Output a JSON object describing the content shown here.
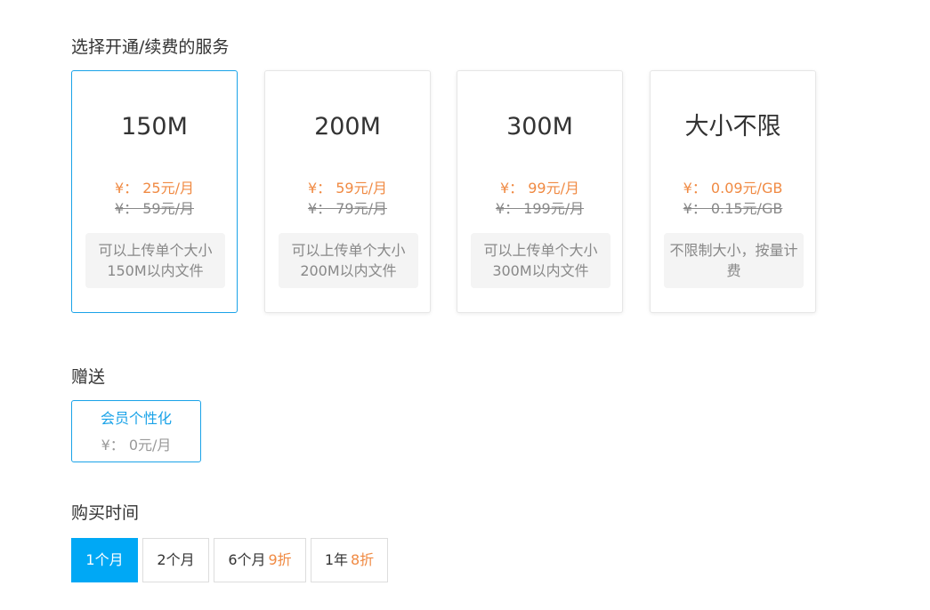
{
  "sections": {
    "service_title": "选择开通/续费的服务",
    "gift_title": "赠送",
    "duration_title": "购买时间"
  },
  "plans": [
    {
      "name": "150M",
      "price": "¥： 25元/月",
      "original_price": "¥： 59元/月",
      "description": "可以上传单个大小150M以内文件",
      "selected": true
    },
    {
      "name": "200M",
      "price": "¥： 59元/月",
      "original_price": "¥： 79元/月",
      "description": "可以上传单个大小200M以内文件",
      "selected": false
    },
    {
      "name": "300M",
      "price": "¥： 99元/月",
      "original_price": "¥： 199元/月",
      "description": "可以上传单个大小300M以内文件",
      "selected": false
    },
    {
      "name": "大小不限",
      "price": "¥： 0.09元/GB",
      "original_price": "¥： 0.15元/GB",
      "description": "不限制大小，按量计费",
      "selected": false
    }
  ],
  "gift": {
    "name": "会员个性化",
    "price": "¥： 0元/月"
  },
  "durations": [
    {
      "label": "1个月",
      "discount": "",
      "active": true
    },
    {
      "label": "2个月",
      "discount": "",
      "active": false
    },
    {
      "label": "6个月",
      "discount": "9折",
      "active": false
    },
    {
      "label": "1年",
      "discount": "8折",
      "active": false
    }
  ],
  "colors": {
    "accent": "#1aa3e8",
    "active_button": "#00a8f5",
    "price": "#f08a43",
    "muted": "#888888"
  }
}
